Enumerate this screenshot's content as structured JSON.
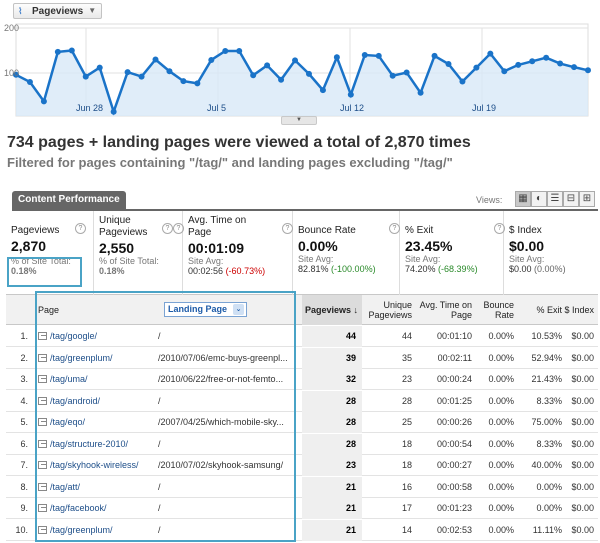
{
  "chart": {
    "metric_label": "Pageviews",
    "y_labels": [
      "200",
      "100"
    ],
    "x_labels": [
      "Jun 28",
      "Jul 5",
      "Jul 12",
      "Jul 19"
    ],
    "line_color": "#1a73c8",
    "fill_color": "#d8e9f7",
    "points": [
      96,
      80,
      37,
      147,
      150,
      92,
      112,
      14,
      102,
      92,
      130,
      104,
      82,
      77,
      129,
      149,
      149,
      95,
      117,
      85,
      128,
      98,
      62,
      135,
      52,
      140,
      138,
      94,
      101,
      56,
      138,
      120,
      81,
      112,
      143,
      104,
      118,
      126,
      134,
      121,
      113,
      106
    ]
  },
  "headline": "734 pages + landing pages were viewed a total of 2,870 times",
  "subline": "Filtered for pages containing \"/tag/\" and landing pages excluding \"/tag/\"",
  "tab_label": "Content Performance",
  "views_label": "Views:",
  "view_buttons": [
    "table-view",
    "pie-view",
    "performance-view",
    "comparison-view",
    "pivot-view"
  ],
  "summary": [
    {
      "label": "Pageviews",
      "value": "2,870",
      "sub1": "% of Site Total:",
      "sub2": "0.18%",
      "avg": "",
      "pct": ""
    },
    {
      "label": "Unique Pageviews",
      "value": "2,550",
      "sub1": "% of Site Total:",
      "sub2": "0.18%",
      "avg": "",
      "pct": ""
    },
    {
      "label": "Avg. Time on Page",
      "value": "00:01:09",
      "sub1": "Site Avg:",
      "sub2": "",
      "avg": "00:02:56",
      "pct": "(-60.73%)",
      "pct_class": "neg"
    },
    {
      "label": "Bounce Rate",
      "value": "0.00%",
      "sub1": "Site Avg:",
      "sub2": "",
      "avg": "82.81%",
      "pct": "(-100.00%)",
      "pct_class": "pos"
    },
    {
      "label": "% Exit",
      "value": "23.45%",
      "sub1": "Site Avg:",
      "sub2": "",
      "avg": "74.20%",
      "pct": "(-68.39%)",
      "pct_class": "pos"
    },
    {
      "label": "$ Index",
      "value": "$0.00",
      "sub1": "Site Avg:",
      "sub2": "",
      "avg": "$0.00",
      "pct": "(0.00%)",
      "pct_class": ""
    }
  ],
  "table": {
    "headers": {
      "page": "Page",
      "landing": "Landing Page",
      "pageviews": "Pageviews",
      "unique": "Unique Pageviews",
      "avg_time": "Avg. Time on Page",
      "bounce": "Bounce Rate",
      "exit": "% Exit",
      "index": "$ Index"
    },
    "rows": [
      {
        "n": "1.",
        "page": "/tag/google/",
        "landing": "/",
        "pv": "44",
        "upv": "44",
        "time": "00:01:10",
        "bounce": "0.00%",
        "exit": "10.53%",
        "index": "$0.00"
      },
      {
        "n": "2.",
        "page": "/tag/greenplum/",
        "landing": "/2010/07/06/emc-buys-greenpl...",
        "pv": "39",
        "upv": "35",
        "time": "00:02:11",
        "bounce": "0.00%",
        "exit": "52.94%",
        "index": "$0.00"
      },
      {
        "n": "3.",
        "page": "/tag/uma/",
        "landing": "/2010/06/22/free-or-not-femto...",
        "pv": "32",
        "upv": "23",
        "time": "00:00:24",
        "bounce": "0.00%",
        "exit": "21.43%",
        "index": "$0.00"
      },
      {
        "n": "4.",
        "page": "/tag/android/",
        "landing": "/",
        "pv": "28",
        "upv": "28",
        "time": "00:01:25",
        "bounce": "0.00%",
        "exit": "8.33%",
        "index": "$0.00"
      },
      {
        "n": "5.",
        "page": "/tag/eqo/",
        "landing": "/2007/04/25/which-mobile-sky...",
        "pv": "28",
        "upv": "25",
        "time": "00:00:26",
        "bounce": "0.00%",
        "exit": "75.00%",
        "index": "$0.00"
      },
      {
        "n": "6.",
        "page": "/tag/structure-2010/",
        "landing": "/",
        "pv": "28",
        "upv": "18",
        "time": "00:00:54",
        "bounce": "0.00%",
        "exit": "8.33%",
        "index": "$0.00"
      },
      {
        "n": "7.",
        "page": "/tag/skyhook-wireless/",
        "landing": "/2010/07/02/skyhook-samsung/",
        "pv": "23",
        "upv": "18",
        "time": "00:00:27",
        "bounce": "0.00%",
        "exit": "40.00%",
        "index": "$0.00"
      },
      {
        "n": "8.",
        "page": "/tag/att/",
        "landing": "/",
        "pv": "21",
        "upv": "16",
        "time": "00:00:58",
        "bounce": "0.00%",
        "exit": "0.00%",
        "index": "$0.00"
      },
      {
        "n": "9.",
        "page": "/tag/facebook/",
        "landing": "/",
        "pv": "21",
        "upv": "17",
        "time": "00:01:23",
        "bounce": "0.00%",
        "exit": "0.00%",
        "index": "$0.00"
      },
      {
        "n": "10.",
        "page": "/tag/greenplum/",
        "landing": "/",
        "pv": "21",
        "upv": "14",
        "time": "00:02:53",
        "bounce": "0.00%",
        "exit": "11.11%",
        "index": "$0.00"
      }
    ]
  }
}
